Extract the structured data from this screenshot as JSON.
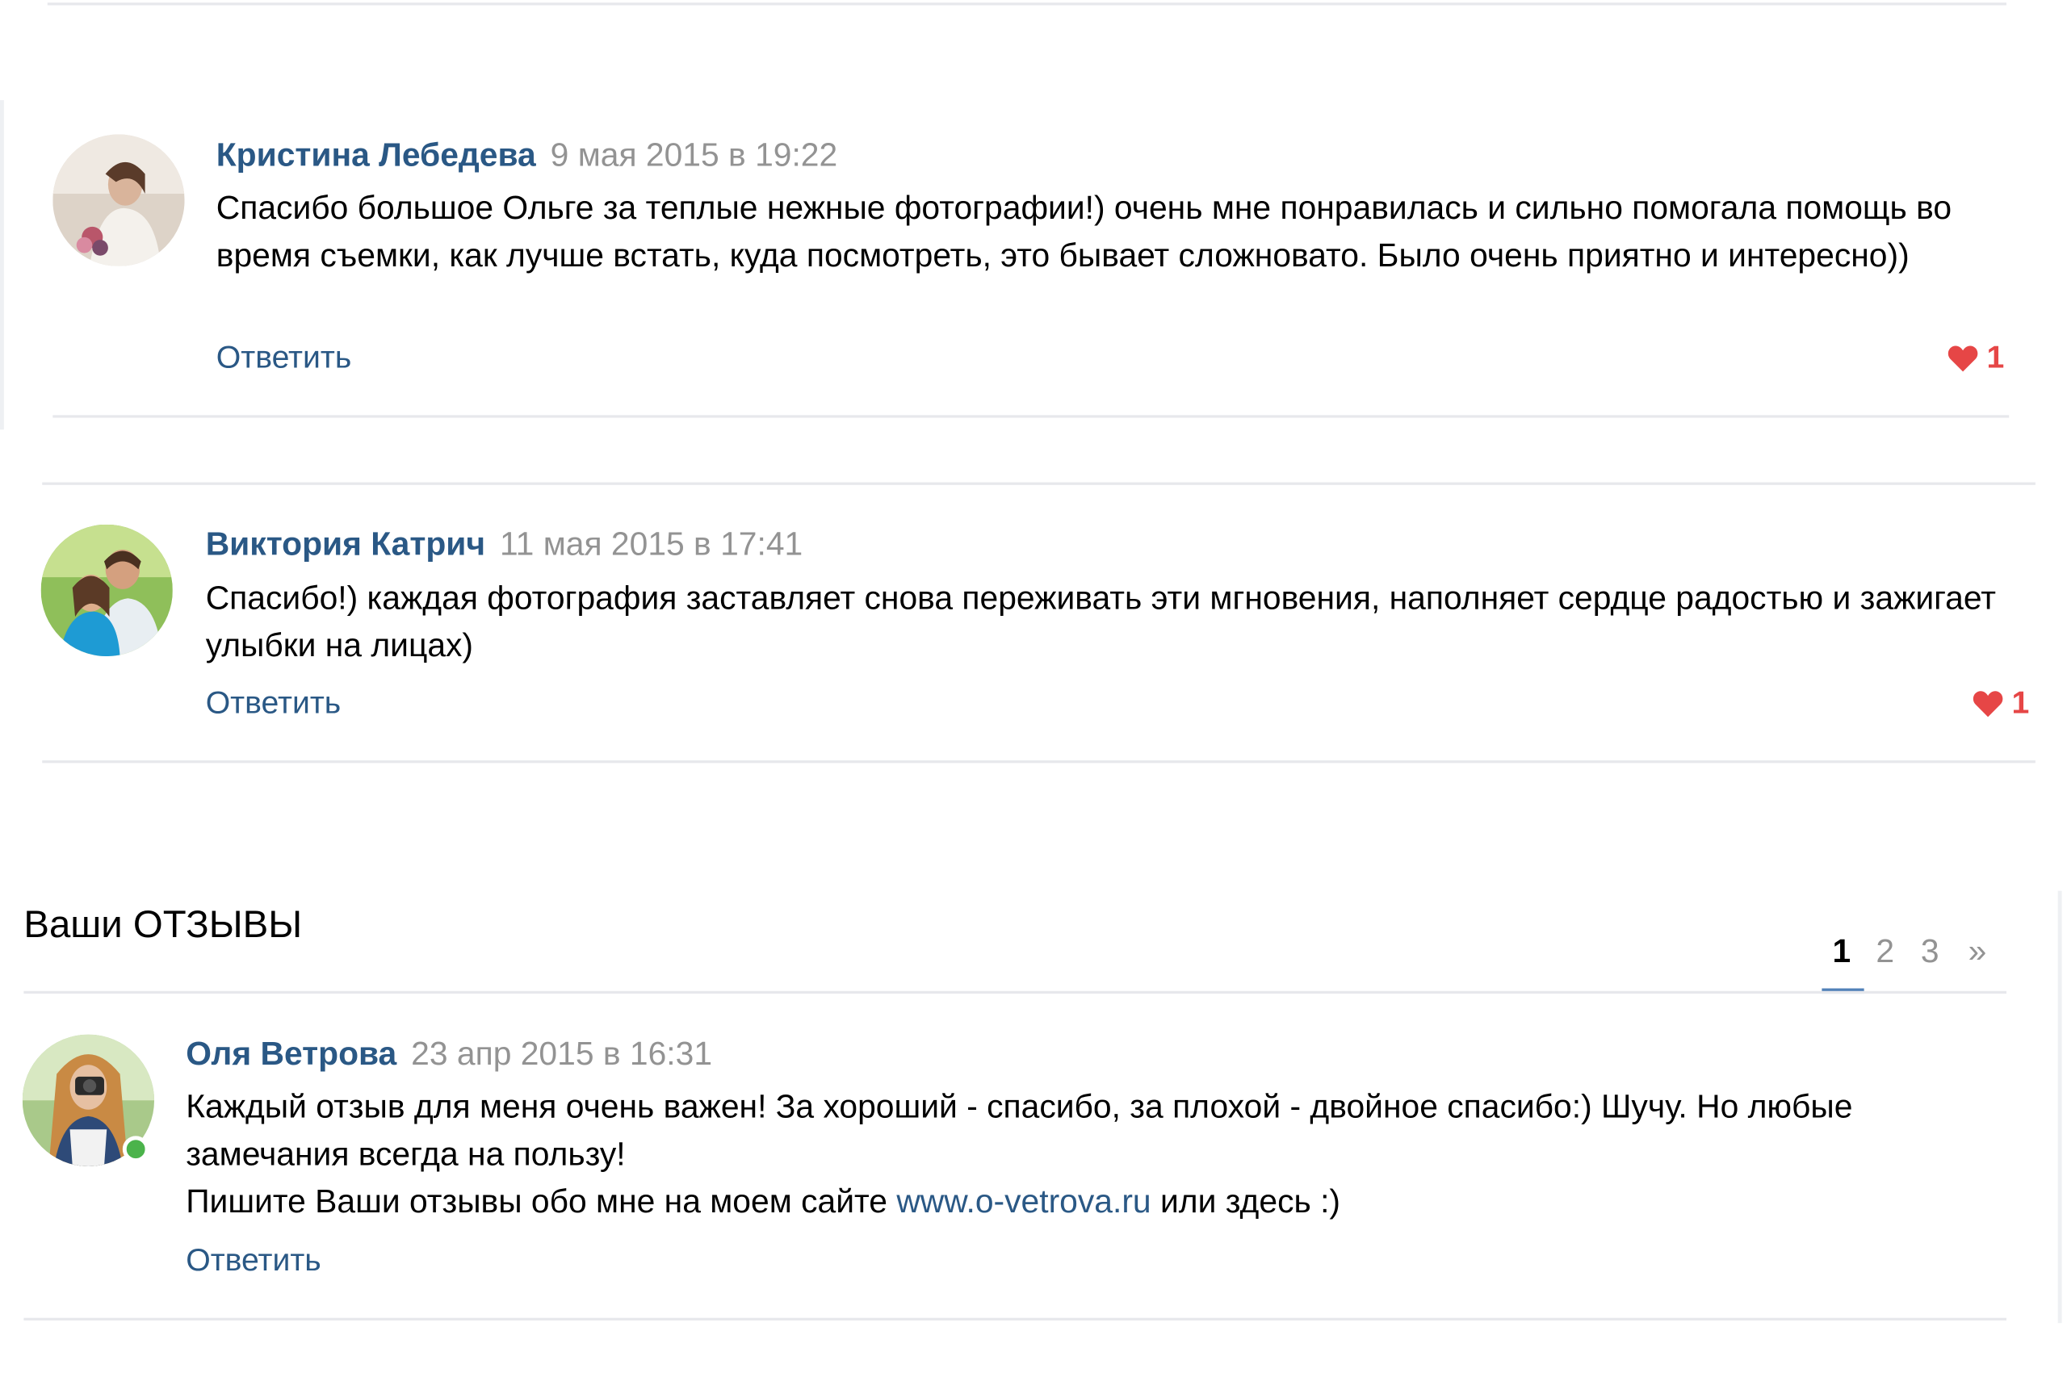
{
  "comments": [
    {
      "author": "Кристина Лебедева",
      "date": "9 мая 2015 в 19:22",
      "text": "Спасибо большое Ольге за теплые нежные фотографии!) очень мне понравилась и сильно помогала помощь во время съемки, как лучше встать, куда посмотреть, это бывает сложновато. Было очень приятно и интересно))",
      "reply_label": "Ответить",
      "likes": "1"
    },
    {
      "author": "Виктория Катрич",
      "date": "11 мая 2015 в 17:41",
      "text": "Спасибо!) каждая фотография заставляет снова переживать эти мгновения, наполняет сердце радостью и зажигает улыбки на лицах)",
      "reply_label": "Ответить",
      "likes": "1"
    }
  ],
  "reviews": {
    "title": "Ваши ОТЗЫВЫ",
    "pages": [
      "1",
      "2",
      "3",
      "»"
    ],
    "active_page": "1",
    "post": {
      "author": "Оля Ветрова",
      "date": "23 апр 2015 в 16:31",
      "line1": "Каждый отзыв для меня очень важен! За хороший - спасибо, за плохой - двойное спасибо:) Шучу. Но любые замечания всегда на пользу!",
      "line2_before": "Пишите Ваши отзывы обо мне на моем сайте",
      "link": "www.o-vetrova.ru",
      "line2_after": "или здесь :)",
      "reply_label": "Ответить"
    }
  },
  "colors": {
    "link": "#2a5885",
    "date": "#939393",
    "like": "#e64646",
    "divider": "#e7e8ec",
    "online": "#4bb34b",
    "pager_accent": "#5181b8"
  }
}
